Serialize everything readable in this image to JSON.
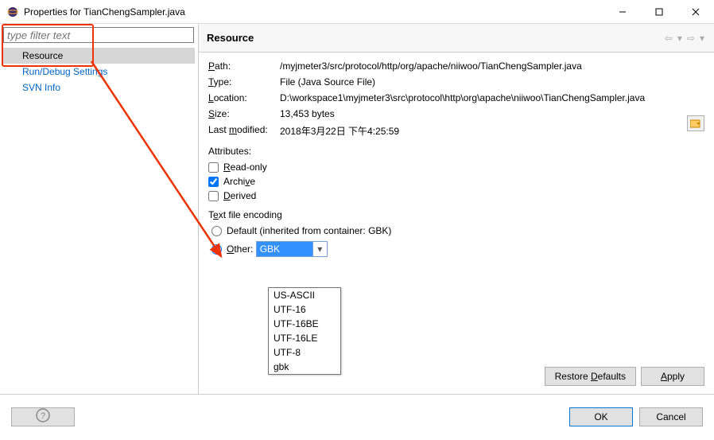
{
  "window": {
    "title": "Properties for TianChengSampler.java"
  },
  "sidebar": {
    "filter_placeholder": "type filter text",
    "items": [
      {
        "label": "Resource"
      },
      {
        "label": "Run/Debug Settings"
      },
      {
        "label": "SVN Info"
      }
    ]
  },
  "header": {
    "title": "Resource"
  },
  "props": {
    "path_label": "Path:",
    "path_value": "/myjmeter3/src/protocol/http/org/apache/niiwoo/TianChengSampler.java",
    "type_label": "Type:",
    "type_value": "File  (Java Source File)",
    "location_label": "Location:",
    "location_value": "D:\\workspace1\\myjmeter3\\src\\protocol\\http\\org\\apache\\niiwoo\\TianChengSampler.java",
    "size_label": "Size:",
    "size_value": "13,453  bytes",
    "modified_label": "Last modified:",
    "modified_value": "2018年3月22日 下午4:25:59"
  },
  "attributes": {
    "label": "Attributes:",
    "readonly": "Read-only",
    "archive": "Archive",
    "derived": "Derived"
  },
  "encoding": {
    "group_label": "Text file encoding",
    "default_label": "Default (inherited from container: GBK)",
    "other_label": "Other:",
    "selected": "GBK",
    "options": [
      "US-ASCII",
      "UTF-16",
      "UTF-16BE",
      "UTF-16LE",
      "UTF-8",
      "gbk"
    ]
  },
  "buttons": {
    "restore": "Restore Defaults",
    "apply": "Apply",
    "ok": "OK",
    "cancel": "Cancel"
  }
}
